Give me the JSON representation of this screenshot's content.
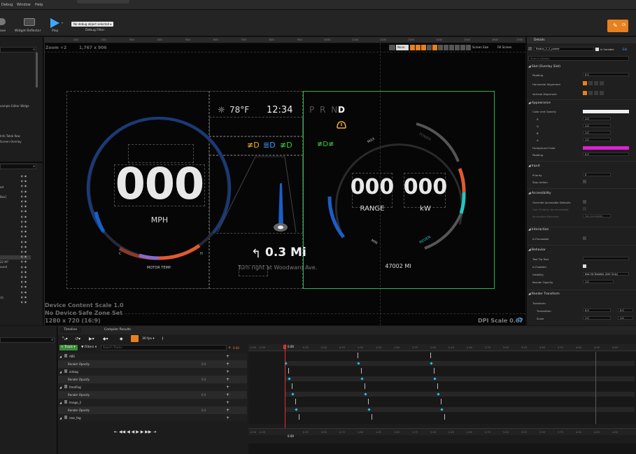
{
  "menu": {
    "items": [
      "Debug",
      "Window",
      "Help"
    ]
  },
  "toolbar": {
    "widget_reflector_label": "Widget Reflector",
    "play_label": "Play",
    "debug_object_value": "No debug object selected",
    "debug_filter_label": "Debug Filter",
    "left_cut_label": "ave",
    "right_button_label": "Di"
  },
  "left_panel": {
    "items_top": [
      "xample Editor Widge",
      "Info Table Row",
      "Screen Overlay"
    ],
    "items_hier": [
      "ad",
      "Box]",
      "22 M?",
      "ound",
      "rt)"
    ]
  },
  "viewport": {
    "zoom_label": "Zoom +2",
    "resolution_label": "1,767 x 906",
    "screen_size_label": "Screen Size",
    "fill_screen_label": "Fill Screen",
    "none_label": "None",
    "scale_info_1": "Device Content Scale 1.0",
    "scale_info_2": "No Device Safe Zone Set",
    "scale_info_3": "1280 x 720 (16:9)",
    "dpi_scale": "DPI Scale 0.67",
    "ruler_ticks": [
      "100",
      "200",
      "300",
      "400",
      "500",
      "600",
      "700",
      "800",
      "900",
      "1000",
      "1100",
      "1200",
      "1300",
      "1400",
      "1500",
      "1600",
      "1700"
    ]
  },
  "cluster": {
    "speed": "000",
    "speed_unit": "MPH",
    "motor_temp_label": "MOTOR TEMP.",
    "temp_c": "C",
    "temp_h": "H",
    "outside_temp": "78°F",
    "clock": "12:34",
    "gear_prnd": "P R N",
    "gear_active": "D",
    "nav_distance": "0.3 Mi",
    "nav_instruction": "Turn right at Woodward Ave.",
    "range_value": "000",
    "range_label": "RANGE",
    "power_value": "000",
    "power_label": "kW",
    "odometer": "47002 MI",
    "gauge_max": "MAX",
    "gauge_power": "POWER",
    "gauge_min": "MIN",
    "gauge_regen": "REGEN",
    "colors": {
      "blue_arc": "#1a5ec8",
      "green_frame": "#2db34a",
      "warning_amber": "#f0b020",
      "lights_green": "#38d040",
      "lights_blue": "#3a9cff",
      "orange_arc": "#e05a30",
      "teal_arc": "#20c8c0"
    }
  },
  "details": {
    "tab_label": "Details",
    "widget_name": "Radial_2_2_power",
    "is_variable_label": "Is Variable",
    "search_placeholder": "Search Details",
    "sections": {
      "slot": "Slot (Overlay Slot)",
      "appearance": "Appearance",
      "input": "Input",
      "accessibility": "Accessibility",
      "interaction": "Interaction",
      "behavior": "Behavior",
      "render_transform": "Render Transform"
    },
    "props": {
      "padding": "Padding",
      "padding_val": "0.0",
      "h_align": "Horizontal Alignment",
      "v_align": "Vertical Alignment",
      "color_opacity": "Color and Opacity",
      "r": "R",
      "g": "G",
      "b": "B",
      "a": "A",
      "one": "1.0",
      "foreground_color": "Foreground Color",
      "padding2": "Padding",
      "padding2_val": "0.0",
      "priority": "Priority",
      "priority_val": "0",
      "stop_action": "Stop Action",
      "override_acc": "Override Accessible Defaults",
      "can_children": "Can Children be Accessible",
      "acc_behavior": "Accessible Behavior",
      "acc_behavior_val": "Not Accessible",
      "is_focusable": "Is Focusable",
      "tooltip_text": "Tool Tip Text",
      "is_enabled": "Is Enabled",
      "visibility": "Visibility",
      "visibility_val": "Not Hit-Testable (Self Only)",
      "render_opacity": "Render Opacity",
      "render_opacity_val": "1.0",
      "transform": "Transform",
      "translation": "Translation",
      "translation_x": "0.0",
      "translation_y": "0.0",
      "scale": "Scale",
      "scale_x": "1.0",
      "scale_y": "1.0"
    }
  },
  "timeline": {
    "tab_timeline": "Timeline",
    "tab_compiler": "Compiler Results",
    "fps": "30 fps",
    "add_track": "Track",
    "filters": "Filters",
    "search_placeholder": "Search Tracks",
    "time_current": "0.00",
    "time_current_bottom": "0.00",
    "tracks": [
      {
        "name": "ABS",
        "child": "Render Opacity",
        "val": "0.0"
      },
      {
        "name": "airbag",
        "child": "Render Opacity",
        "val": "0.0"
      },
      {
        "name": "frontFog",
        "child": "Render Opacity",
        "val": "0.0"
      },
      {
        "name": "Image_2",
        "child": "Render Opacity",
        "val": "0.0"
      },
      {
        "name": "rear_fog",
        "child": "",
        "val": ""
      }
    ],
    "ticks": [
      "0.00",
      "0.25",
      "0.50",
      "0.75",
      "1.00",
      "1.25",
      "1.50",
      "1.75",
      "2.00",
      "2.25",
      "2.50",
      "2.75",
      "3.00",
      "3.25",
      "3.50",
      "3.75",
      "4.00",
      "4.25",
      "4.50"
    ],
    "neg_ticks": [
      "-0.50",
      "-0.25"
    ],
    "end_marker": "3.00"
  }
}
